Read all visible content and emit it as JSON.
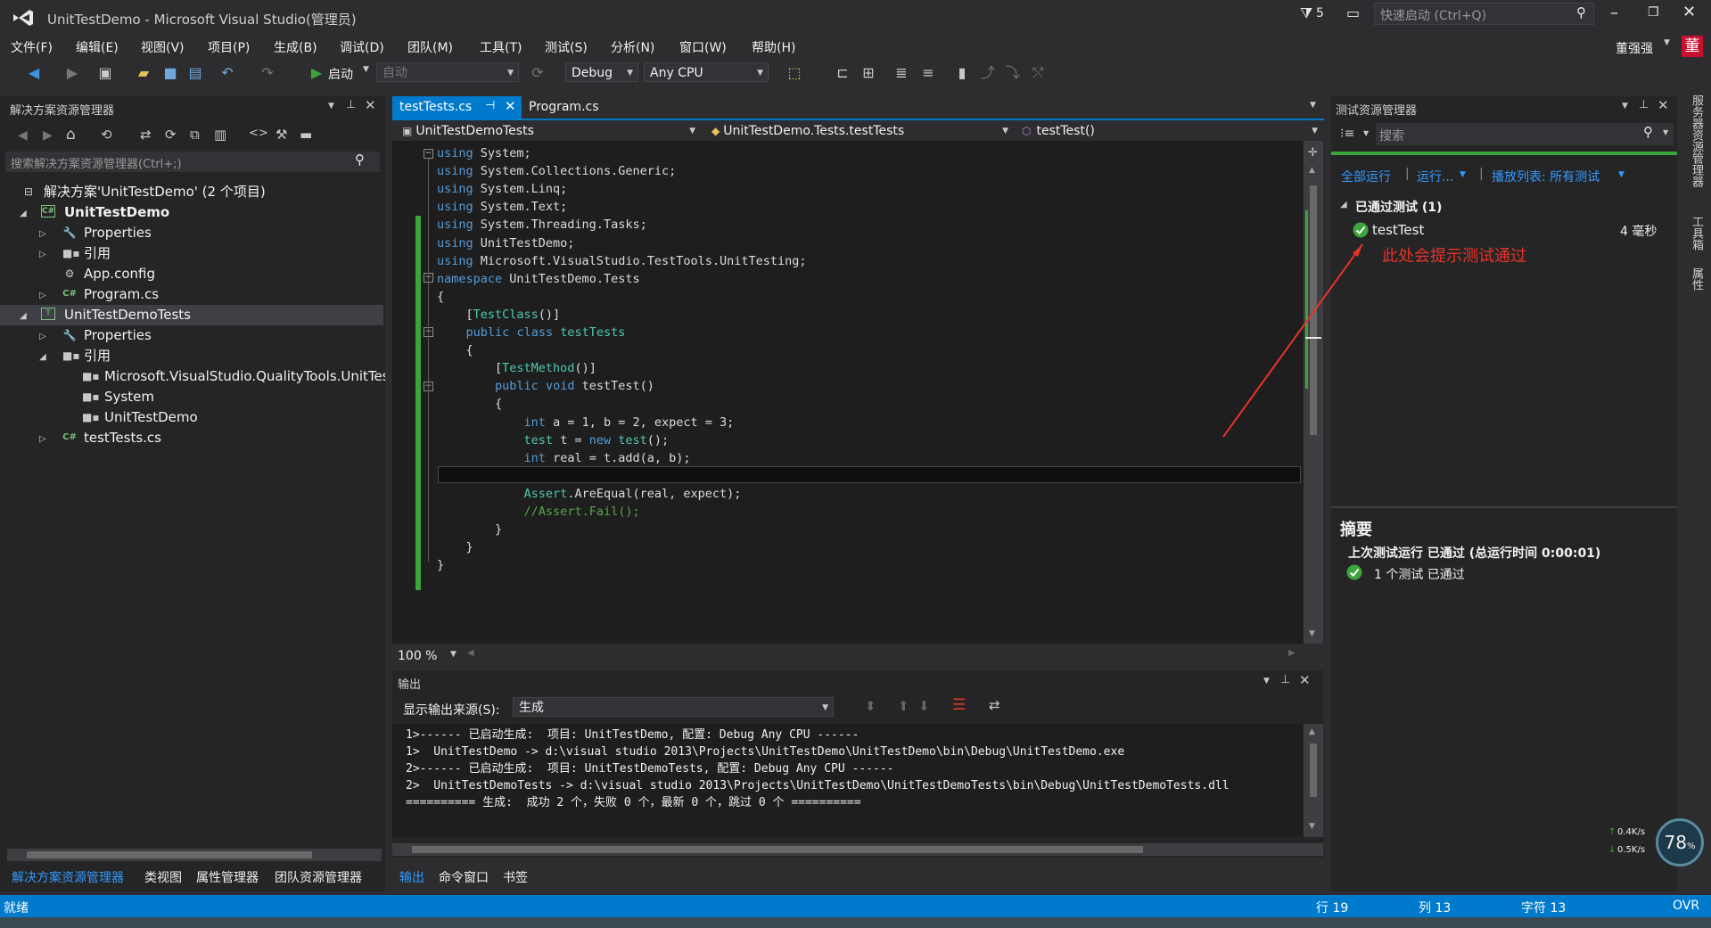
{
  "window": {
    "title": "UnitTestDemo - Microsoft Visual Studio(管理员)",
    "filter_count": "5",
    "quick_launch_placeholder": "快速启动 (Ctrl+Q)",
    "user_name": "董强强",
    "user_avatar_char": "董"
  },
  "menu": [
    "文件(F)",
    "编辑(E)",
    "视图(V)",
    "项目(P)",
    "生成(B)",
    "调试(D)",
    "团队(M)",
    "工具(T)",
    "测试(S)",
    "分析(N)",
    "窗口(W)",
    "帮助(H)"
  ],
  "toolbar": {
    "start_label": "启动",
    "auto_label": "自动",
    "config": "Debug",
    "platform": "Any CPU"
  },
  "solution_explorer": {
    "title": "解决方案资源管理器",
    "search_placeholder": "搜索解决方案资源管理器(Ctrl+;)",
    "tree": [
      {
        "label": "解决方案'UnitTestDemo' (2 个项目)",
        "icon": "solution-icon"
      },
      {
        "label": "UnitTestDemo",
        "icon": "csharp-project-icon"
      },
      {
        "label": "Properties",
        "icon": "wrench-icon"
      },
      {
        "label": "引用",
        "icon": "references-icon"
      },
      {
        "label": "App.config",
        "icon": "config-file-icon"
      },
      {
        "label": "Program.cs",
        "icon": "csharp-file-icon"
      },
      {
        "label": "UnitTestDemoTests",
        "icon": "test-project-icon"
      },
      {
        "label": "Properties",
        "icon": "wrench-icon"
      },
      {
        "label": "引用",
        "icon": "references-icon"
      },
      {
        "label": "Microsoft.VisualStudio.QualityTools.UnitTes",
        "icon": "assembly-icon"
      },
      {
        "label": "System",
        "icon": "assembly-icon"
      },
      {
        "label": "UnitTestDemo",
        "icon": "assembly-icon"
      },
      {
        "label": "testTests.cs",
        "icon": "csharp-file-icon"
      }
    ],
    "bottom_tabs": [
      "解决方案资源管理器",
      "类视图",
      "属性管理器",
      "团队资源管理器"
    ]
  },
  "editor": {
    "tabs": [
      "testTests.cs",
      "Program.cs"
    ],
    "nav_project": "UnitTestDemoTests",
    "nav_class": "UnitTestDemo.Tests.testTests",
    "nav_member": "testTest()",
    "zoom": "100 %",
    "lines": [
      [
        [
          "kw",
          "using"
        ],
        [
          "t",
          " System;"
        ]
      ],
      [
        [
          "kw",
          "using"
        ],
        [
          "t",
          " System.Collections.Generic;"
        ]
      ],
      [
        [
          "kw",
          "using"
        ],
        [
          "t",
          " System.Linq;"
        ]
      ],
      [
        [
          "kw",
          "using"
        ],
        [
          "t",
          " System.Text;"
        ]
      ],
      [
        [
          "kw",
          "using"
        ],
        [
          "t",
          " System.Threading.Tasks;"
        ]
      ],
      [
        [
          "kw",
          "using"
        ],
        [
          "t",
          " UnitTestDemo;"
        ]
      ],
      [
        [
          "kw",
          "using"
        ],
        [
          "t",
          " Microsoft.VisualStudio.TestTools.UnitTesting;"
        ]
      ],
      [
        [
          "kw",
          "namespace"
        ],
        [
          "t",
          " UnitTestDemo.Tests"
        ]
      ],
      [
        [
          "t",
          "{"
        ]
      ],
      [
        [
          "t",
          "    ["
        ],
        [
          "ty",
          "TestClass"
        ],
        [
          "t",
          "()]"
        ]
      ],
      [
        [
          "t",
          "    "
        ],
        [
          "kw",
          "public"
        ],
        [
          "t",
          " "
        ],
        [
          "kw",
          "class"
        ],
        [
          "t",
          " "
        ],
        [
          "ty",
          "testTests"
        ]
      ],
      [
        [
          "t",
          "    {"
        ]
      ],
      [
        [
          "t",
          "        ["
        ],
        [
          "ty",
          "TestMethod"
        ],
        [
          "t",
          "()]"
        ]
      ],
      [
        [
          "t",
          "        "
        ],
        [
          "kw",
          "public"
        ],
        [
          "t",
          " "
        ],
        [
          "kw",
          "void"
        ],
        [
          "t",
          " testTest()"
        ]
      ],
      [
        [
          "t",
          "        {"
        ]
      ],
      [
        [
          "t",
          "            "
        ],
        [
          "kw",
          "int"
        ],
        [
          "t",
          " a = 1, b = 2, expect = 3;"
        ]
      ],
      [
        [
          "t",
          "            "
        ],
        [
          "ty",
          "test"
        ],
        [
          "t",
          " t = "
        ],
        [
          "kw",
          "new"
        ],
        [
          "t",
          " "
        ],
        [
          "ty",
          "test"
        ],
        [
          "t",
          "();"
        ]
      ],
      [
        [
          "t",
          "            "
        ],
        [
          "kw",
          "int"
        ],
        [
          "t",
          " real = t.add(a, b);"
        ]
      ],
      [
        [
          "t",
          ""
        ]
      ],
      [
        [
          "t",
          "            "
        ],
        [
          "ty",
          "Assert"
        ],
        [
          "t",
          ".AreEqual(real, expect);"
        ]
      ],
      [
        [
          "t",
          "            "
        ],
        [
          "cm",
          "//Assert.Fail();"
        ]
      ],
      [
        [
          "t",
          "        }"
        ]
      ],
      [
        [
          "t",
          "    }"
        ]
      ],
      [
        [
          "t",
          "}"
        ]
      ]
    ]
  },
  "output": {
    "title": "输出",
    "source_label": "显示输出来源(S):",
    "source_value": "生成",
    "lines": [
      "1>------ 已启动生成:  项目: UnitTestDemo, 配置: Debug Any CPU ------",
      "1>  UnitTestDemo -> d:\\visual studio 2013\\Projects\\UnitTestDemo\\UnitTestDemo\\bin\\Debug\\UnitTestDemo.exe",
      "2>------ 已启动生成:  项目: UnitTestDemoTests, 配置: Debug Any CPU ------",
      "2>  UnitTestDemoTests -> d:\\visual studio 2013\\Projects\\UnitTestDemo\\UnitTestDemoTests\\bin\\Debug\\UnitTestDemoTests.dll",
      "========== 生成:  成功 2 个，失败 0 个，最新 0 个，跳过 0 个 =========="
    ],
    "bottom_tabs": [
      "输出",
      "命令窗口",
      "书签"
    ]
  },
  "test_explorer": {
    "title": "测试资源管理器",
    "search_placeholder": "搜索",
    "run_all": "全部运行",
    "run": "运行...",
    "playlist": "播放列表: 所有测试",
    "group_label": "已通过测试 (1)",
    "test_name": "testTest",
    "test_duration": "4 毫秒",
    "annotation": "此处会提示测试通过",
    "summary_title": "摘要",
    "summary_last_run": "上次测试运行 已通过 (总运行时间 0:00:01)",
    "summary_count": "1 个测试 已通过"
  },
  "side_tabs": [
    "服务器资源管理器",
    "工具箱",
    "属性"
  ],
  "net_widget": {
    "up": "0.4K/s",
    "down": "0.5K/s",
    "percent": "78"
  },
  "statusbar": {
    "ready": "就绪",
    "row": "行 19",
    "col": "列 13",
    "char": "字符 13",
    "mode": "OVR"
  },
  "colors": {
    "accent": "#007acc",
    "pass": "#3ba53b",
    "annotation": "#e8332a",
    "link": "#3399ff"
  }
}
